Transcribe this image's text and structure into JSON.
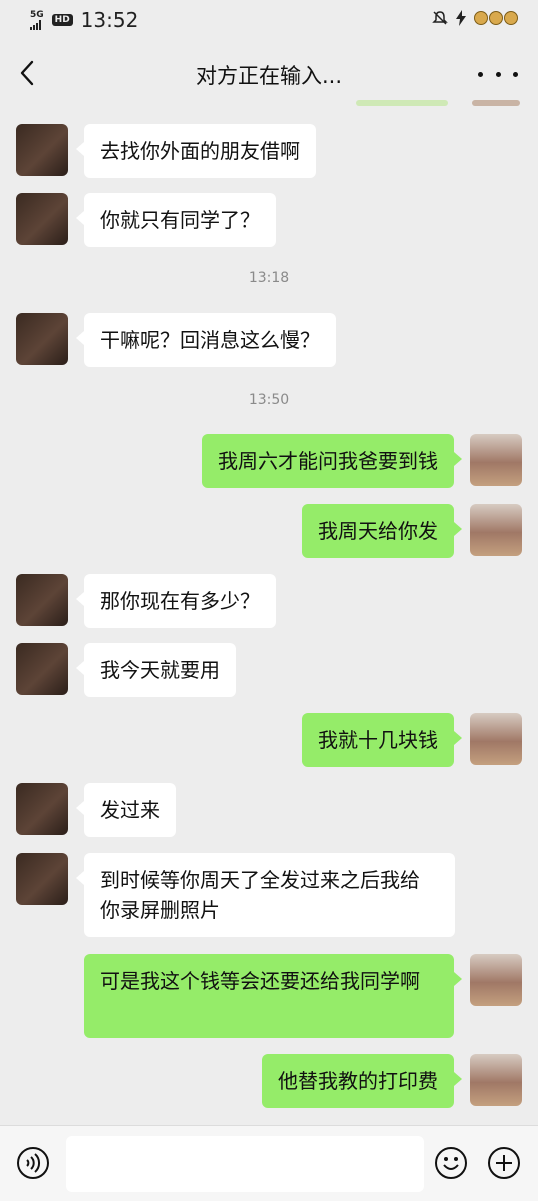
{
  "status": {
    "network": "5G",
    "hd": "HD",
    "time": "13:52"
  },
  "header": {
    "title": "对方正在输入..."
  },
  "messages": [
    {
      "side": "in",
      "text": "去找你外面的朋友借啊"
    },
    {
      "side": "in",
      "text": "你就只有同学了？"
    },
    {
      "timestamp": "13:18"
    },
    {
      "side": "in",
      "text": "干嘛呢？回消息这么慢？"
    },
    {
      "timestamp": "13:50"
    },
    {
      "side": "out",
      "text": "我周六才能问我爸要到钱"
    },
    {
      "side": "out",
      "text": "我周天给你发"
    },
    {
      "side": "in",
      "text": "那你现在有多少？"
    },
    {
      "side": "in",
      "text": "我今天就要用"
    },
    {
      "side": "out",
      "text": "我就十几块钱"
    },
    {
      "side": "in",
      "text": "发过来"
    },
    {
      "side": "in",
      "text": "到时候等你周天了全发过来之后我给你录屏删照片"
    },
    {
      "side": "out",
      "text": "可是我这个钱等会还要还给我同学啊"
    },
    {
      "side": "out",
      "text": "他替我教的打印费"
    }
  ],
  "colors": {
    "chat_bg": "#ededed",
    "incoming_bubble": "#ffffff",
    "outgoing_bubble": "#95ec69"
  }
}
